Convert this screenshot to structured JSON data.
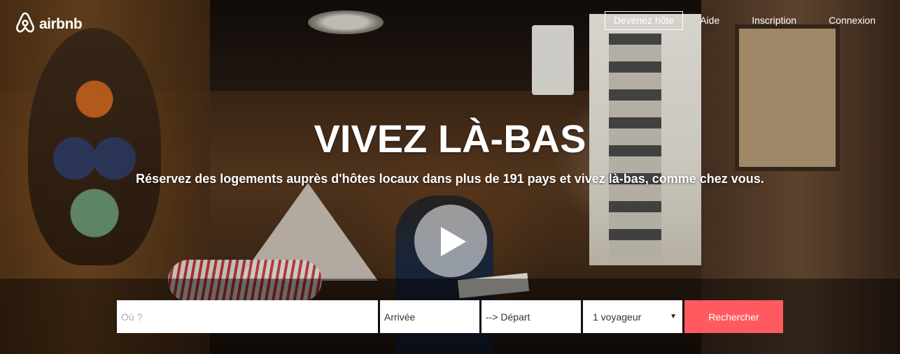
{
  "brand": {
    "name": "airbnb",
    "logo_icon": "airbnb-belo-icon"
  },
  "nav": {
    "host_label": "Devenez hôte",
    "links": [
      "Aide",
      "Inscription",
      "Connexion"
    ]
  },
  "hero": {
    "headline": "VIVEZ LÀ-BAS",
    "subline": "Réservez des logements auprès d'hôtes locaux dans plus de 191 pays et vivez là-bas, comme chez vous.",
    "play_icon": "play-icon"
  },
  "search": {
    "where_placeholder": "Où ?",
    "checkin_value": "Arrivée",
    "checkout_value": "--> Départ",
    "guests_value": "1 voyageur",
    "submit_label": "Rechercher"
  },
  "colors": {
    "accent": "#ff5a5f"
  }
}
